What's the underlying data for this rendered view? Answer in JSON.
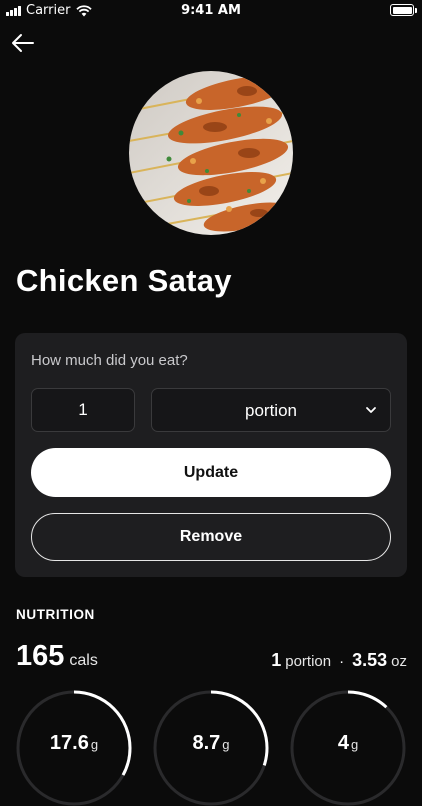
{
  "status_bar": {
    "carrier": "Carrier",
    "time": "9:41 AM"
  },
  "food": {
    "title": "Chicken Satay",
    "image_icon": "chicken-satay-photo"
  },
  "entry": {
    "question": "How much did you eat?",
    "quantity": "1",
    "unit": "portion",
    "update_label": "Update",
    "remove_label": "Remove"
  },
  "nutrition": {
    "heading": "NUTRITION",
    "calories_value": "165",
    "calories_unit": "cals",
    "portion_qty": "1",
    "portion_unit": "portion",
    "separator": "·",
    "weight_value": "3.53",
    "weight_unit": "oz",
    "macros": [
      {
        "value": "17.6",
        "unit": "g",
        "progress": 0.33
      },
      {
        "value": "8.7",
        "unit": "g",
        "progress": 0.3
      },
      {
        "value": "4",
        "unit": "g",
        "progress": 0.12
      }
    ]
  },
  "colors": {
    "background": "#0b0b0b",
    "card": "#1e1e20",
    "ring_track": "#2a2a2c",
    "ring_fill": "#ffffff"
  }
}
